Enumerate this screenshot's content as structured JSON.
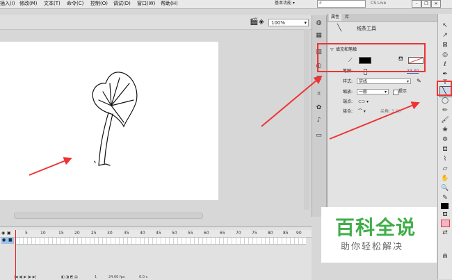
{
  "menu": [
    "插入(I)",
    "修改(M)",
    "文本(T)",
    "命令(C)",
    "控制(O)",
    "调试(D)",
    "窗口(W)",
    "帮助(H)"
  ],
  "workspace_label": "基本功能 ▾",
  "cs_live": "CS Live",
  "zoom": "100%",
  "panel": {
    "tabs": [
      "属性",
      "库"
    ],
    "tool_name": "线条工具",
    "section_title": "填充和笔触",
    "stroke_label": "笔触:",
    "stroke_value": "33.30",
    "style_label": "样式:",
    "style_value": "实线",
    "scale_label": "缩放:",
    "scale_value": "一般",
    "hint_label": "提示",
    "cap_label": "端点:",
    "join_label": "接合:",
    "miter_label": "尖角:",
    "miter_value": "3.00"
  },
  "timeline": {
    "frame_numbers": [
      "5",
      "10",
      "15",
      "20",
      "25",
      "30",
      "35",
      "40",
      "45",
      "50",
      "55",
      "60",
      "65",
      "70",
      "75",
      "80",
      "85",
      "90"
    ],
    "fps": "24.00 fps",
    "time": "0.0 s",
    "frame": "1"
  },
  "watermark": {
    "title": "百科全说",
    "subtitle": "助你轻松解决"
  },
  "colors": {
    "stroke": "#000000",
    "fill": "#ffffff",
    "accent_red": "#e33333",
    "watermark_green": "#3fae49"
  }
}
